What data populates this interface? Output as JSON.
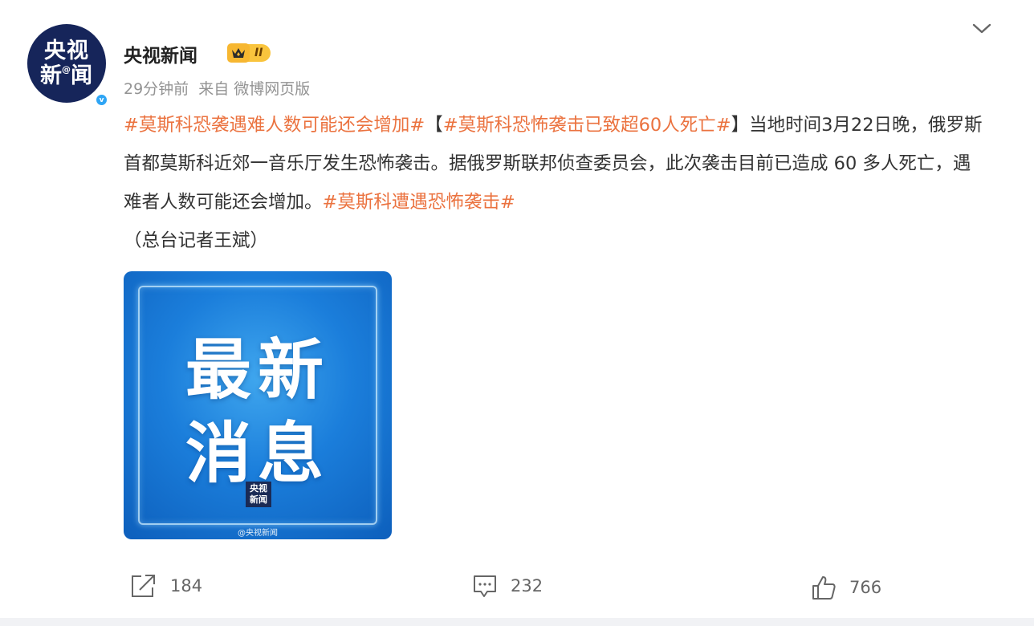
{
  "account": {
    "avatar_line1": "央视",
    "avatar_line2a": "新",
    "avatar_at": "@",
    "avatar_line2b": "闻",
    "verified_mark": "v",
    "name": "央视新闻",
    "level_label": "II",
    "level_icon": "crown-icon"
  },
  "meta": {
    "time": "29分钟前",
    "source": "来自 微博网页版"
  },
  "post": {
    "topic1": "#莫斯科恐袭遇难人数可能还会增加#",
    "bracket_open": "【",
    "topic2": "#莫斯科恐怖袭击已致超60人死亡#",
    "bracket_close": "】",
    "body": "当地时间3月22日晚，俄罗斯首都莫斯科近郊一音乐厅发生恐怖袭击。据俄罗斯联邦侦查委员会，此次袭击目前已造成 60 多人死亡，遇难者人数可能还会增加。",
    "topic3": "#莫斯科遭遇恐怖袭击#",
    "credit": "（总台记者王斌）"
  },
  "image": {
    "line1": "最新",
    "line2": "消息",
    "logo_line1": "央视",
    "logo_line2": "新闻",
    "watermark": "@央视新闻"
  },
  "actions": {
    "share_count": "184",
    "comment_count": "232",
    "like_count": "766"
  },
  "colors": {
    "topic": "#eb7340",
    "avatar_bg": "#16255a",
    "verified": "#2ea5f5",
    "badge": "#f9c43d"
  }
}
